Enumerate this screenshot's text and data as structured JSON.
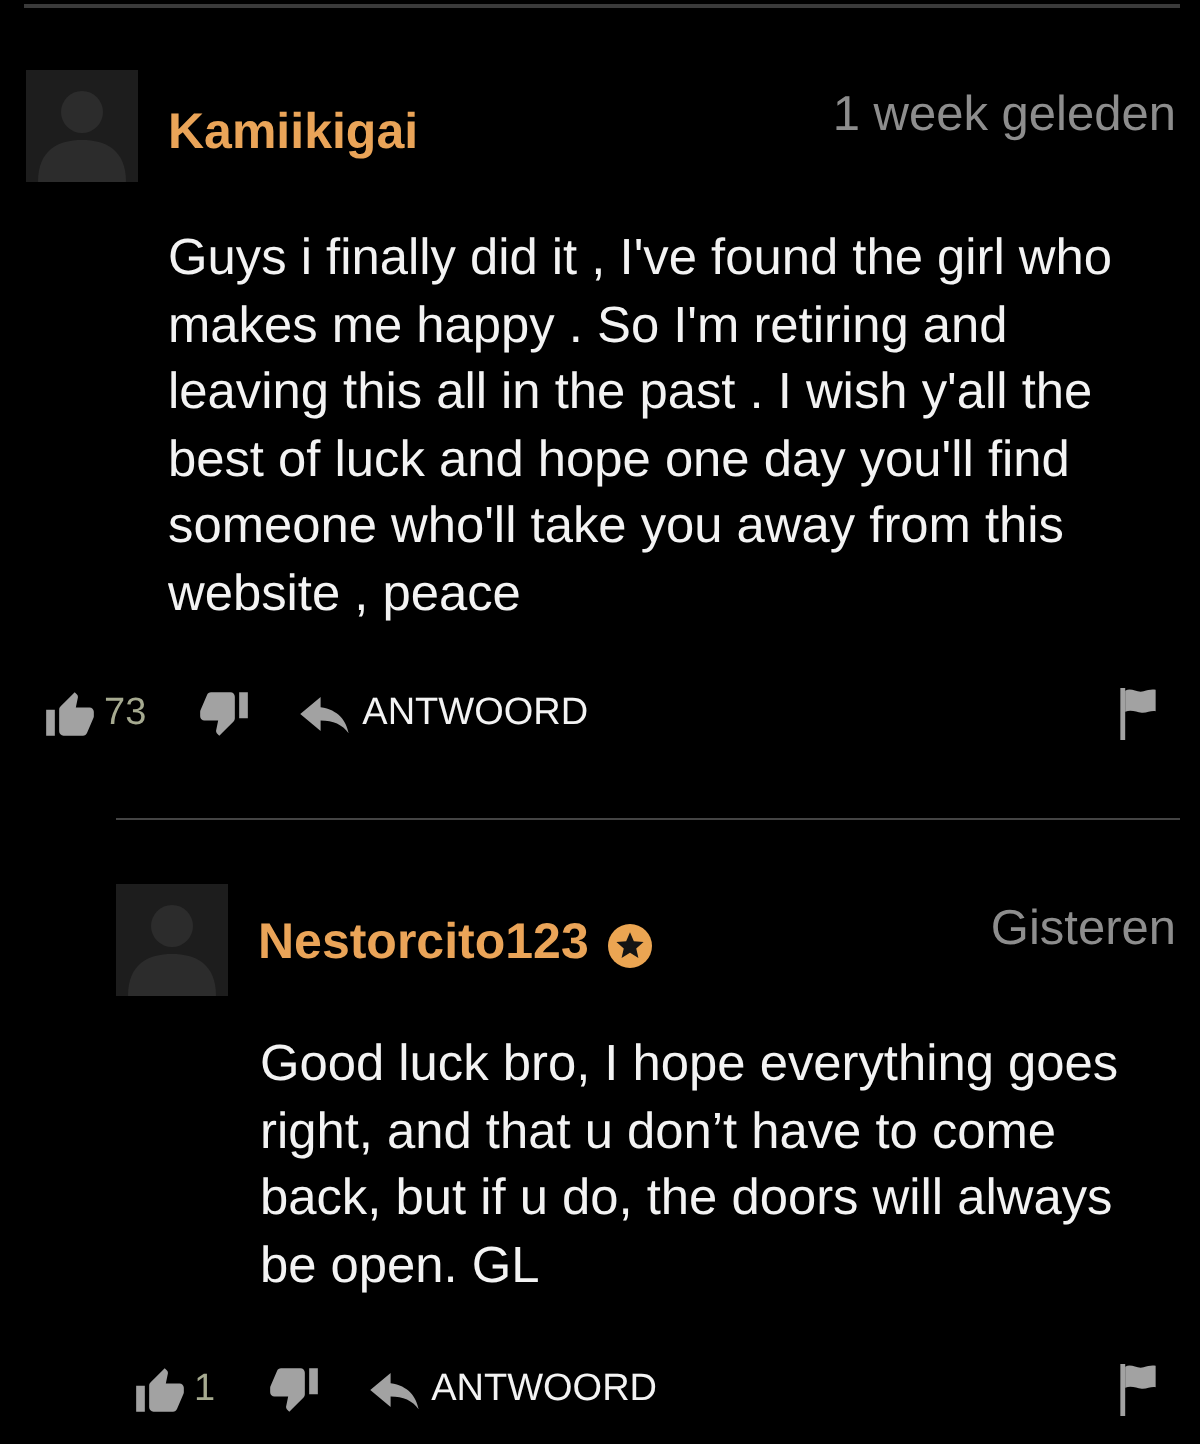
{
  "comments": [
    {
      "author": "Kamiikigai",
      "badge": false,
      "time": "1 week geleden",
      "text": "Guys i finally did it , I've found the girl who makes me happy . So I'm retiring and leaving this all in the past . I wish y'all the best of luck and hope one day you'll find someone who'll take you away from this website , peace",
      "likes": "73",
      "reply_label": "ANTWOORD",
      "replies": [
        {
          "author": "Nestorcito123",
          "badge": true,
          "time": "Gisteren",
          "text": "Good luck bro, I hope everything goes right, and that u don’t have to come back, but if u do, the doors will always be open. GL",
          "likes": "1",
          "reply_label": "ANTWOORD"
        }
      ]
    }
  ]
}
